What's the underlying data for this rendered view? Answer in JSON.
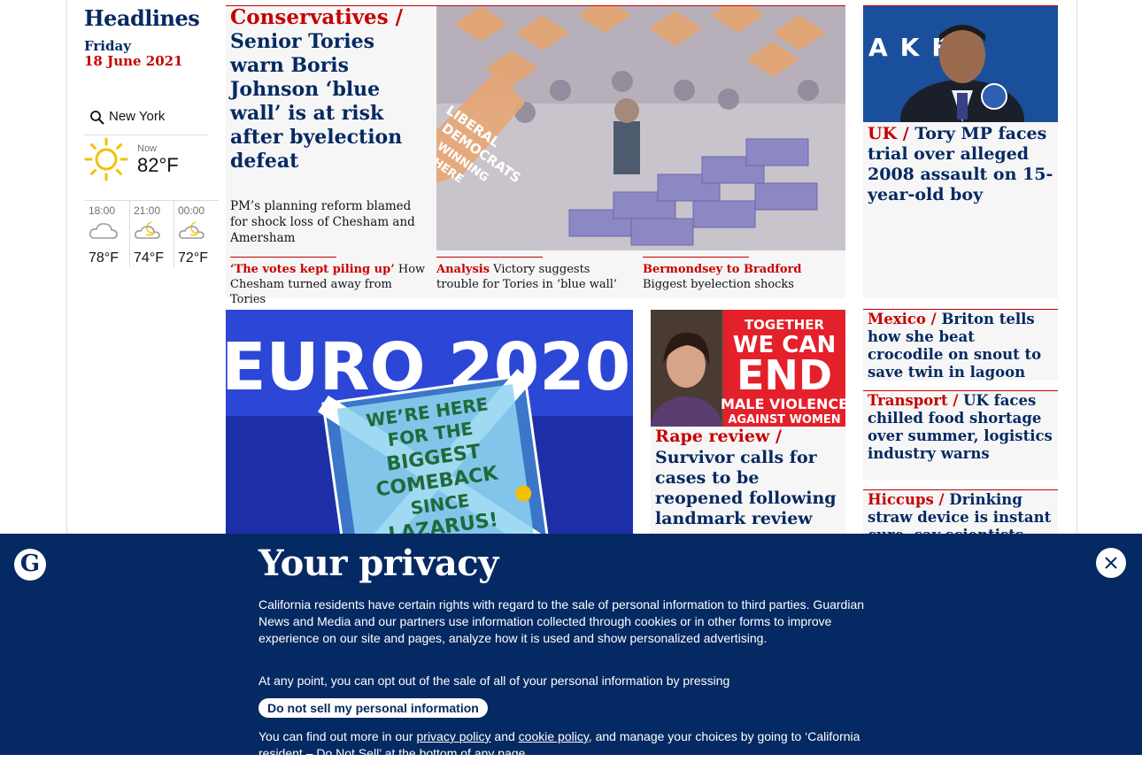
{
  "sidebar": {
    "title": "Headlines",
    "day": "Friday",
    "date": "18 June 2021",
    "weather": {
      "location": "New York",
      "now_label": "Now",
      "now_temp": "82°F",
      "now_icon": "sun-icon",
      "forecast": [
        {
          "time": "18:00",
          "temp": "78°F",
          "icon": "cloud-icon"
        },
        {
          "time": "21:00",
          "temp": "74°F",
          "icon": "cloud-moon-icon"
        },
        {
          "time": "00:00",
          "temp": "72°F",
          "icon": "cloud-moon-icon"
        }
      ]
    }
  },
  "lead": {
    "kicker": "Conservatives /",
    "headline": "Senior Tories warn Boris Johnson ‘blue wall’ is at risk after byelection defeat",
    "standfirst": "PM’s planning reform blamed for shock loss of Chesham and Amersham",
    "subs": [
      {
        "kicker": "‘The votes kept piling up’",
        "text": "How Chesham turned away from Tories"
      },
      {
        "kicker": "Analysis",
        "text": "Victory suggests trouble for Tories in ‘blue wall’"
      },
      {
        "kicker": "Bermondsey to Bradford",
        "text": "Biggest byelection shocks"
      }
    ]
  },
  "right_column": [
    {
      "kicker": "UK /",
      "headline": "Tory MP faces trial over alleged 2008 assault on 15-year-old boy"
    },
    {
      "kicker": "Mexico /",
      "headline": "Briton tells how she beat crocodile on snout to save twin in lagoon"
    },
    {
      "kicker": "Transport /",
      "headline": "UK faces chilled food shortage over summer, logistics industry warns"
    },
    {
      "kicker": "Hiccups /",
      "headline": "Drinking straw device is instant cure, say scientists"
    }
  ],
  "euro_image": {
    "banner_text": "EURO 2020",
    "sign_lines": [
      "WE’RE HERE",
      "FOR THE",
      "BIGGEST",
      "COMEBACK",
      "SINCE",
      "LAZARUS!"
    ]
  },
  "rape_story": {
    "kicker": "Rape review  /",
    "headline": "Survivor calls for cases to be reopened following landmark review",
    "sign_lines": [
      "TOGETHER",
      "WE CAN",
      "END",
      "MALE VIOLENCE",
      "AGAINST WOMEN"
    ]
  },
  "lead_image": {
    "sign_lines": [
      "LIBERAL",
      "DEMOCRATS",
      "WINNING",
      "HERE"
    ]
  },
  "privacy": {
    "title": "Your privacy",
    "p1": "California residents have certain rights with regard to the sale of personal information to third parties. Guardian News and Media and our partners use information collected through cookies or in other forms to improve experience on our site and pages, analyze how it is used and show personalized advertising.",
    "p2": "At any point, you can opt out of the sale of all of your personal information by pressing",
    "button": "Do not sell my personal information",
    "p3_start": "You can find out more in our ",
    "privacy_link": "privacy policy",
    "and": " and ",
    "cookie_link": "cookie policy",
    "p3_end": ", and manage your choices by going to ‘California resident – Do Not Sell’ at the bottom of any page.",
    "logo": "G"
  },
  "colors": {
    "brand": "#052962",
    "news": "#c70000",
    "card": "#f6f6f6"
  }
}
